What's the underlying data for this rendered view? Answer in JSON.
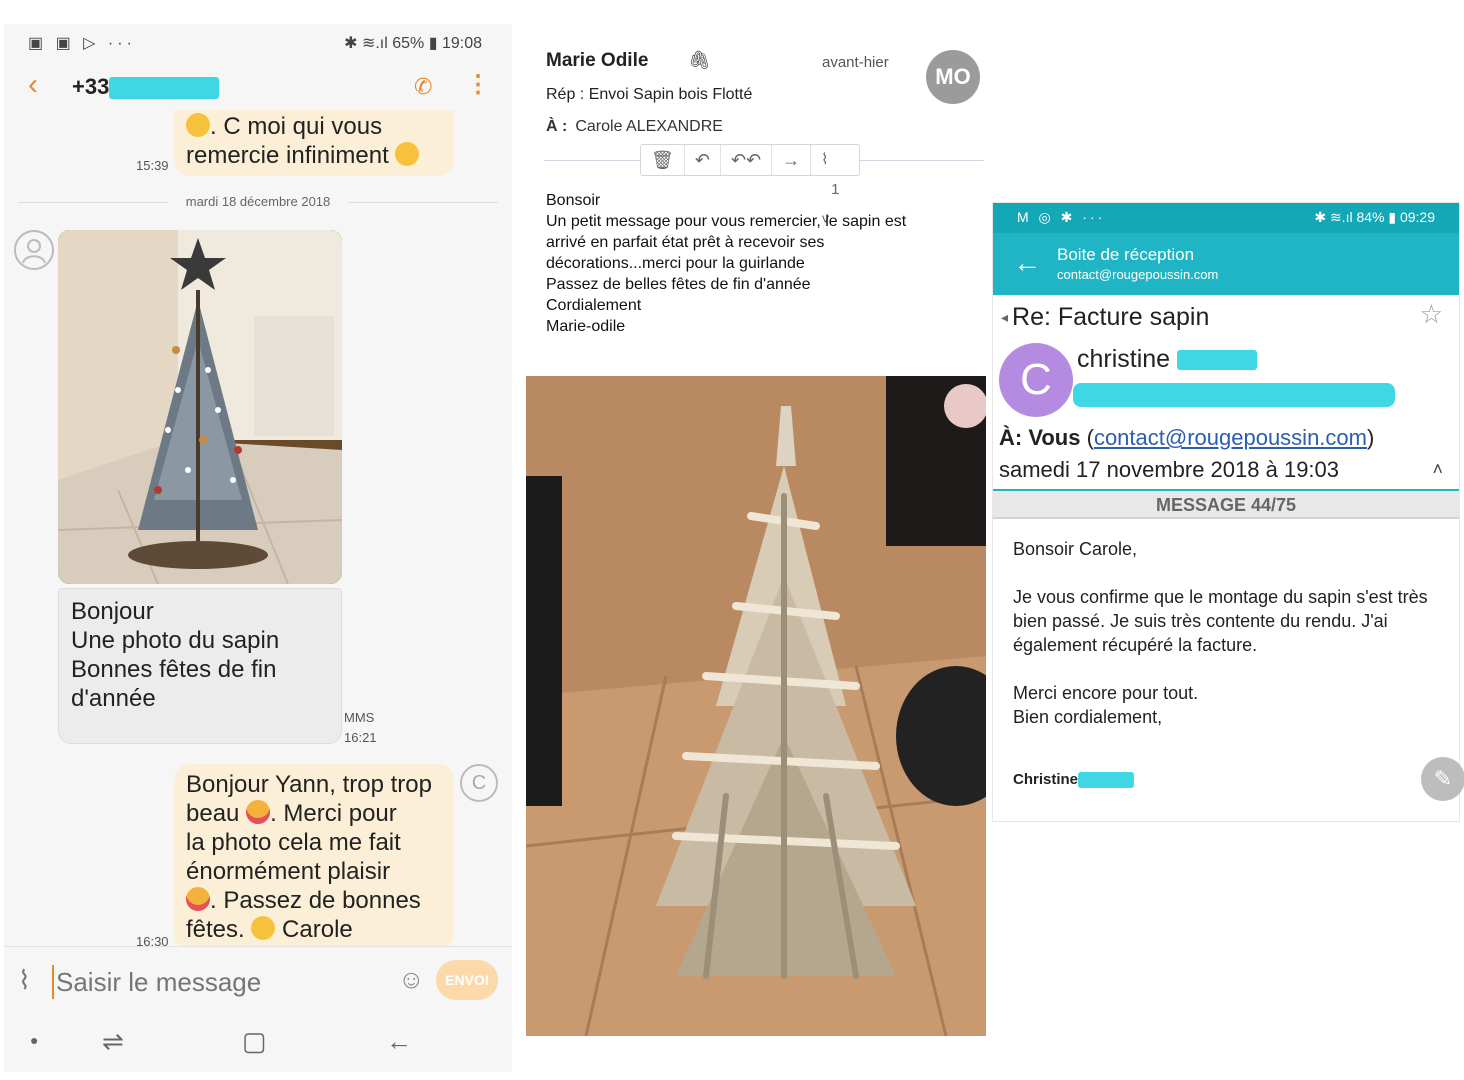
{
  "sms": {
    "status_left": "▣ ▣ ▷ ···",
    "status_right": "✱ ≋.ıl 65% ▮ 19:08",
    "contact_prefix": "+33",
    "prev_text_1": ". C moi qui vous",
    "prev_text_2": "remercie infiniment",
    "prev_time": "15:39",
    "date_separator": "mardi 18 décembre 2018",
    "in_line_1": "Bonjour",
    "in_line_2": "Une photo du sapin",
    "in_line_3": "Bonnes fêtes de fin",
    "in_line_4": "d'année",
    "in_type": "MMS",
    "in_time": "16:21",
    "out_line_1": "Bonjour Yann, trop trop",
    "out_line_2a": "beau",
    "out_line_2b": ". Merci pour",
    "out_line_3": "la photo cela me fait",
    "out_line_4": "énormément plaisir",
    "out_line_5": ". Passez de bonnes",
    "out_line_6a": "fêtes.",
    "out_line_6b": "Carole",
    "out_time": "16:30",
    "avatar_letter": "C",
    "input_placeholder": "Saisir le message",
    "send_label": "ENVOI"
  },
  "mail2": {
    "sender": "Marie Odile",
    "date": "avant-hier",
    "avatar": "MO",
    "subject": "Rép : Envoi Sapin bois Flotté",
    "to_label": "À :",
    "to_name": "Carole ALEXANDRE",
    "attachment_count": "1",
    "body_lines": [
      "Bonsoir",
      "Un petit message pour vous remercier, le sapin est",
      "arrivé en parfait état prêt à recevoir ses",
      "décorations...merci pour la guirlande",
      "Passez de belles fêtes de fin d'année",
      "Cordialement",
      "Marie-odile"
    ]
  },
  "mail3": {
    "status_left": "M ◎ ✱ ···",
    "status_right": "✱ ≋.ıl 84% ▮ 09:29",
    "header_title": "Boite de réception",
    "header_account": "contact@rougepoussin.com",
    "subject": "Re: Facture sapin",
    "avatar_letter": "C",
    "sender_name": "christine",
    "to_label": "À: Vous",
    "to_email": "contact@rougepoussin.com",
    "date": "samedi 17 novembre 2018 à 19:03",
    "message_count": "MESSAGE 44/75",
    "greeting": "Bonsoir Carole,",
    "para1": "Je vous confirme que le montage du sapin s'est très bien passé. Je suis très contente du rendu. J'ai également récupéré la facture.",
    "para2_line1": "Merci encore pour tout.",
    "para2_line2": "Bien cordialement,",
    "signature": "Christine"
  }
}
